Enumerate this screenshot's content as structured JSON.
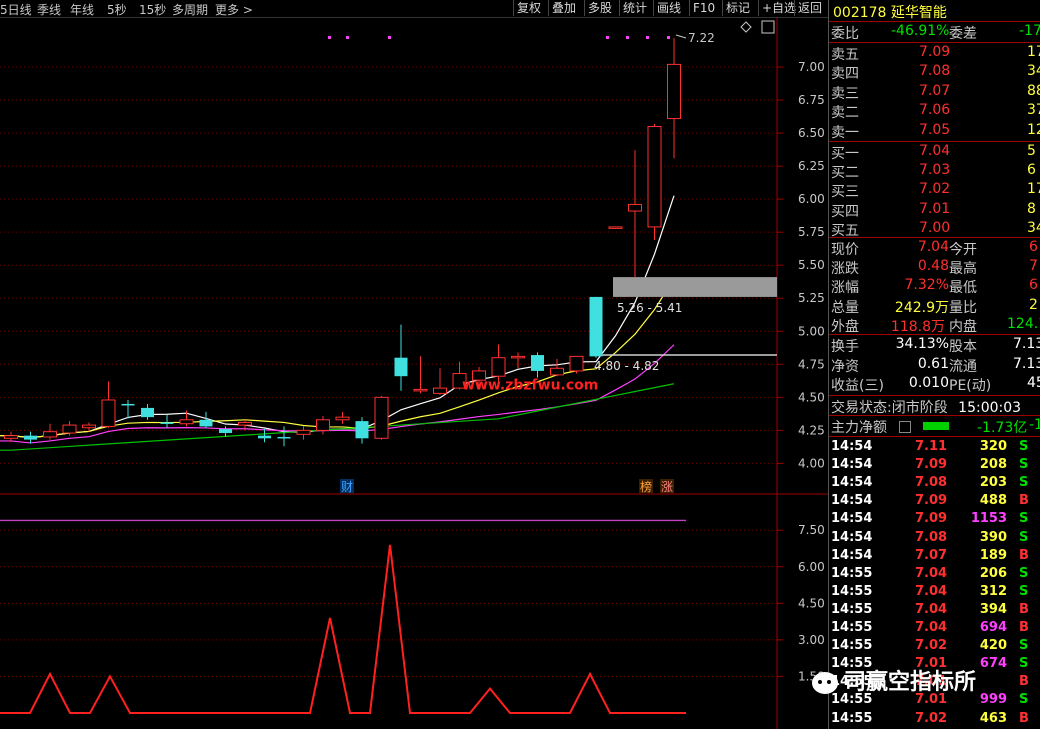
{
  "toolbar": {
    "periods": [
      "5日线",
      "季线",
      "年线",
      "5秒",
      "15秒",
      "多周期",
      "更多 >"
    ],
    "buttons": [
      "复权",
      "叠加",
      "多股",
      "统计",
      "画线",
      "F10",
      "标记",
      "+自选",
      "返回"
    ]
  },
  "stock": {
    "code": "002178",
    "name": "延华智能"
  },
  "chart_data": [
    {
      "type": "candlestick",
      "title": "",
      "yticks": [
        "7.00",
        "6.75",
        "6.50",
        "6.25",
        "6.00",
        "5.75",
        "5.50",
        "5.25",
        "5.00",
        "4.75",
        "4.50",
        "4.25",
        "4.00"
      ],
      "ylim": [
        3.95,
        7.25
      ],
      "annotations": {
        "high_label": "7.22",
        "zone_upper": "5.26 - 5.41",
        "zone_lower": "4.80 - 4.82",
        "watermark_text": "www.zbzfwu.com",
        "event_markers": [
          "财",
          "榜",
          "涨"
        ]
      },
      "candles": [
        {
          "o": 4.19,
          "c": 4.21,
          "h": 4.24,
          "l": 4.16
        },
        {
          "o": 4.21,
          "c": 4.18,
          "h": 4.24,
          "l": 4.15
        },
        {
          "o": 4.2,
          "c": 4.24,
          "h": 4.3,
          "l": 4.18
        },
        {
          "o": 4.23,
          "c": 4.29,
          "h": 4.32,
          "l": 4.21
        },
        {
          "o": 4.27,
          "c": 4.29,
          "h": 4.31,
          "l": 4.24
        },
        {
          "o": 4.28,
          "c": 4.48,
          "h": 4.62,
          "l": 4.27
        },
        {
          "o": 4.45,
          "c": 4.44,
          "h": 4.48,
          "l": 4.34
        },
        {
          "o": 4.42,
          "c": 4.35,
          "h": 4.45,
          "l": 4.33
        },
        {
          "o": 4.31,
          "c": 4.3,
          "h": 4.37,
          "l": 4.27
        },
        {
          "o": 4.3,
          "c": 4.33,
          "h": 4.4,
          "l": 4.28
        },
        {
          "o": 4.33,
          "c": 4.28,
          "h": 4.39,
          "l": 4.27
        },
        {
          "o": 4.26,
          "c": 4.23,
          "h": 4.28,
          "l": 4.2
        },
        {
          "o": 4.29,
          "c": 4.31,
          "h": 4.33,
          "l": 4.25
        },
        {
          "o": 4.21,
          "c": 4.19,
          "h": 4.26,
          "l": 4.16
        },
        {
          "o": 4.2,
          "c": 4.19,
          "h": 4.28,
          "l": 4.13
        },
        {
          "o": 4.22,
          "c": 4.25,
          "h": 4.28,
          "l": 4.18
        },
        {
          "o": 4.25,
          "c": 4.33,
          "h": 4.36,
          "l": 4.22
        },
        {
          "o": 4.33,
          "c": 4.35,
          "h": 4.39,
          "l": 4.3
        },
        {
          "o": 4.32,
          "c": 4.19,
          "h": 4.35,
          "l": 4.15
        },
        {
          "o": 4.19,
          "c": 4.5,
          "h": 4.51,
          "l": 4.18
        },
        {
          "o": 4.8,
          "c": 4.66,
          "h": 5.05,
          "l": 4.55
        },
        {
          "o": 4.56,
          "c": 4.56,
          "h": 4.81,
          "l": 4.53
        },
        {
          "o": 4.53,
          "c": 4.57,
          "h": 4.72,
          "l": 4.52
        },
        {
          "o": 4.57,
          "c": 4.68,
          "h": 4.77,
          "l": 4.56
        },
        {
          "o": 4.63,
          "c": 4.7,
          "h": 4.73,
          "l": 4.57
        },
        {
          "o": 4.66,
          "c": 4.8,
          "h": 4.9,
          "l": 4.62
        },
        {
          "o": 4.81,
          "c": 4.81,
          "h": 4.84,
          "l": 4.72
        },
        {
          "o": 4.82,
          "c": 4.7,
          "h": 4.84,
          "l": 4.65
        },
        {
          "o": 4.67,
          "c": 4.72,
          "h": 4.79,
          "l": 4.66
        },
        {
          "o": 4.7,
          "c": 4.81,
          "h": 4.81,
          "l": 4.68
        },
        {
          "o": 5.26,
          "c": 4.81,
          "h": 5.26,
          "l": 4.8
        },
        {
          "o": 5.79,
          "c": 5.79,
          "h": 5.79,
          "l": 5.79
        },
        {
          "o": 5.91,
          "c": 5.96,
          "h": 6.37,
          "l": 5.41
        },
        {
          "o": 5.79,
          "c": 6.55,
          "h": 6.57,
          "l": 5.69
        },
        {
          "o": 6.61,
          "c": 7.02,
          "h": 7.22,
          "l": 6.31
        }
      ],
      "ma_lines": [
        "white",
        "yellow",
        "magenta",
        "green"
      ]
    },
    {
      "type": "line",
      "title": "",
      "yticks": [
        "7.50",
        "6.00",
        "4.50",
        "3.00",
        "1.50"
      ],
      "ylim": [
        0,
        8
      ],
      "series": [
        {
          "values": [
            0,
            0,
            1.6,
            0,
            0,
            1.5,
            0,
            0,
            0,
            0,
            0,
            0,
            0,
            0,
            0,
            0,
            3.9,
            0,
            0,
            6.9,
            0,
            0,
            0,
            0,
            1,
            0,
            0,
            0,
            0,
            1.6,
            0,
            0,
            0,
            0
          ]
        },
        {
          "values": [
            7.9,
            7.9,
            7.9,
            7.9,
            7.9,
            7.9,
            7.9,
            7.9,
            7.9,
            7.9,
            7.9,
            7.9,
            7.9,
            7.9,
            7.9,
            7.9,
            7.9,
            7.9,
            7.9,
            7.9,
            7.9,
            7.9,
            7.9,
            7.9,
            7.9,
            7.9,
            7.9,
            7.9,
            7.9,
            7.9,
            7.9,
            7.9,
            7.9,
            7.9
          ]
        }
      ]
    }
  ],
  "quote": {
    "weibi_label": "委比",
    "weibi_value": "-46.91%",
    "weicha_label": "委差",
    "weicha_value": "-17",
    "asks": [
      {
        "label": "卖五",
        "price": "7.09",
        "vol": "17"
      },
      {
        "label": "卖四",
        "price": "7.08",
        "vol": "34"
      },
      {
        "label": "卖三",
        "price": "7.07",
        "vol": "88"
      },
      {
        "label": "卖二",
        "price": "7.06",
        "vol": "37"
      },
      {
        "label": "卖一",
        "price": "7.05",
        "vol": "12"
      }
    ],
    "bids": [
      {
        "label": "买一",
        "price": "7.04",
        "vol": "5"
      },
      {
        "label": "买二",
        "price": "7.03",
        "vol": "6"
      },
      {
        "label": "买三",
        "price": "7.02",
        "vol": "17"
      },
      {
        "label": "买四",
        "price": "7.01",
        "vol": "8"
      },
      {
        "label": "买五",
        "price": "7.00",
        "vol": "34"
      }
    ],
    "stats": [
      {
        "l1": "现价",
        "v1": "7.04",
        "l2": "今开",
        "v2": "6"
      },
      {
        "l1": "涨跌",
        "v1": "0.48",
        "l2": "最高",
        "v2": "7"
      },
      {
        "l1": "涨幅",
        "v1": "7.32%",
        "l2": "最低",
        "v2": "6"
      },
      {
        "l1": "总量",
        "v1": "242.9万",
        "l2": "量比",
        "v2": "2"
      },
      {
        "l1": "外盘",
        "v1": "118.8万",
        "l2": "内盘",
        "v2": "124.1"
      }
    ],
    "stats2": [
      {
        "l1": "换手",
        "v1": "34.13%",
        "l2": "股本",
        "v2": "7.13"
      },
      {
        "l1": "净资",
        "v1": "0.61",
        "l2": "流通",
        "v2": "7.13"
      },
      {
        "l1": "收益(三)",
        "v1": "0.010",
        "l2": "PE(动)",
        "v2": "45"
      }
    ],
    "state_label": "交易状态:",
    "state_value": "闭市阶段",
    "state_time": "15:00:03",
    "mainflow_label": "主力净额",
    "mainflow_value": "-1.73亿",
    "mainflow_tail": "-1"
  },
  "trades": [
    {
      "t": "14:54",
      "p": "7.11",
      "v": "320",
      "s": "S"
    },
    {
      "t": "14:54",
      "p": "7.09",
      "v": "208",
      "s": "S"
    },
    {
      "t": "14:54",
      "p": "7.08",
      "v": "203",
      "s": "S"
    },
    {
      "t": "14:54",
      "p": "7.09",
      "v": "488",
      "s": "B"
    },
    {
      "t": "14:54",
      "p": "7.09",
      "v": "1153",
      "s": "S"
    },
    {
      "t": "14:54",
      "p": "7.08",
      "v": "390",
      "s": "S"
    },
    {
      "t": "14:54",
      "p": "7.07",
      "v": "189",
      "s": "B"
    },
    {
      "t": "14:55",
      "p": "7.04",
      "v": "206",
      "s": "S"
    },
    {
      "t": "14:55",
      "p": "7.04",
      "v": "312",
      "s": "S"
    },
    {
      "t": "14:55",
      "p": "7.04",
      "v": "394",
      "s": "B"
    },
    {
      "t": "14:55",
      "p": "7.04",
      "v": "694",
      "s": "B"
    },
    {
      "t": "14:55",
      "p": "7.02",
      "v": "420",
      "s": "S"
    },
    {
      "t": "14:55",
      "p": "7.01",
      "v": "674",
      "s": "S"
    },
    {
      "t": "14:55",
      "p": "7.01",
      "v": "",
      "s": "B"
    },
    {
      "t": "14:55",
      "p": "7.01",
      "v": "999",
      "s": "S"
    },
    {
      "t": "14:55",
      "p": "7.02",
      "v": "463",
      "s": "B"
    }
  ],
  "watermark": "司赢空指标所"
}
